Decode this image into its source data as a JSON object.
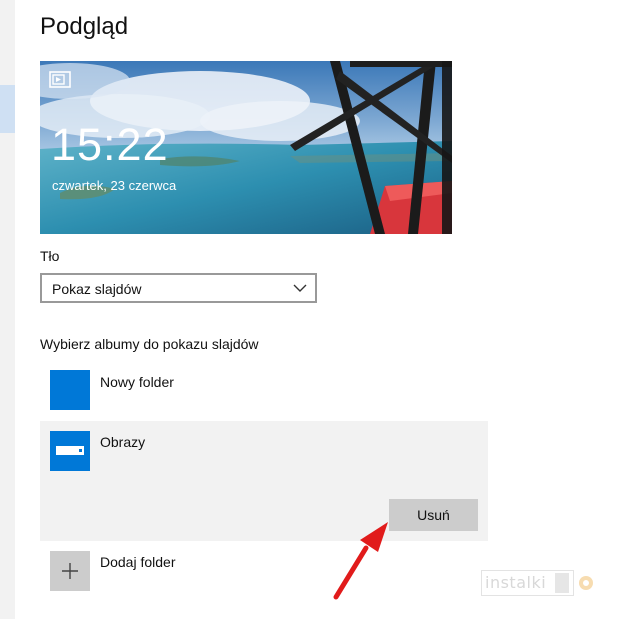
{
  "page": {
    "title": "Podgląd"
  },
  "preview": {
    "time": "15:22",
    "date": "czwartek, 23 czerwca",
    "icon": "slideshow-icon"
  },
  "background": {
    "label": "Tło",
    "selected": "Pokaz slajdów"
  },
  "albums": {
    "label": "Wybierz albumy do pokazu slajdów",
    "items": [
      {
        "name": "Nowy folder",
        "icon": "folder-tile"
      },
      {
        "name": "Obrazy",
        "icon": "pictures-tile",
        "selected": true
      }
    ],
    "remove_label": "Usuń",
    "add_label": "Dodaj folder"
  },
  "watermark": {
    "text": "instalki"
  },
  "colors": {
    "accent": "#0078d7",
    "arrow": "#e11b1b",
    "selected_bg": "#f2f2f2",
    "button_bg": "#cccccc"
  }
}
